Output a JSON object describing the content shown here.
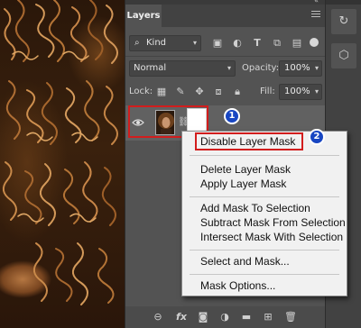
{
  "panel": {
    "tab_label": "Layers",
    "filter": {
      "label": "Kind"
    },
    "blend_mode": "Normal",
    "opacity_label": "Opacity:",
    "opacity_value": "100%",
    "lock_label": "Lock:",
    "fill_label": "Fill:",
    "fill_value": "100%",
    "filter_icons": [
      "image-filter-icon",
      "adjustment-filter-icon",
      "type-filter-icon",
      "shape-filter-icon",
      "smart-object-filter-icon"
    ],
    "lock_icons": [
      "lock-transparent-icon",
      "lock-image-icon",
      "lock-position-icon",
      "lock-artboard-icon",
      "lock-all-icon"
    ],
    "bottom_icons": [
      "link-layers-icon",
      "fx-icon",
      "add-mask-icon",
      "new-adjustment-icon",
      "new-group-icon",
      "new-layer-icon",
      "delete-layer-icon"
    ]
  },
  "layer": {
    "visible": true
  },
  "annotations": {
    "badge1": "1",
    "badge2": "2"
  },
  "context_menu": {
    "items": [
      "Disable Layer Mask",
      "Delete Layer Mask",
      "Apply Layer Mask",
      "Add Mask To Selection",
      "Subtract Mask From Selection",
      "Intersect Mask With Selection",
      "Select and Mask...",
      "Mask Options..."
    ]
  },
  "colors": {
    "highlight": "#d21d1d",
    "badge": "#1846c2",
    "panel_bg": "#535353",
    "menu_bg": "#f1f1f1"
  }
}
